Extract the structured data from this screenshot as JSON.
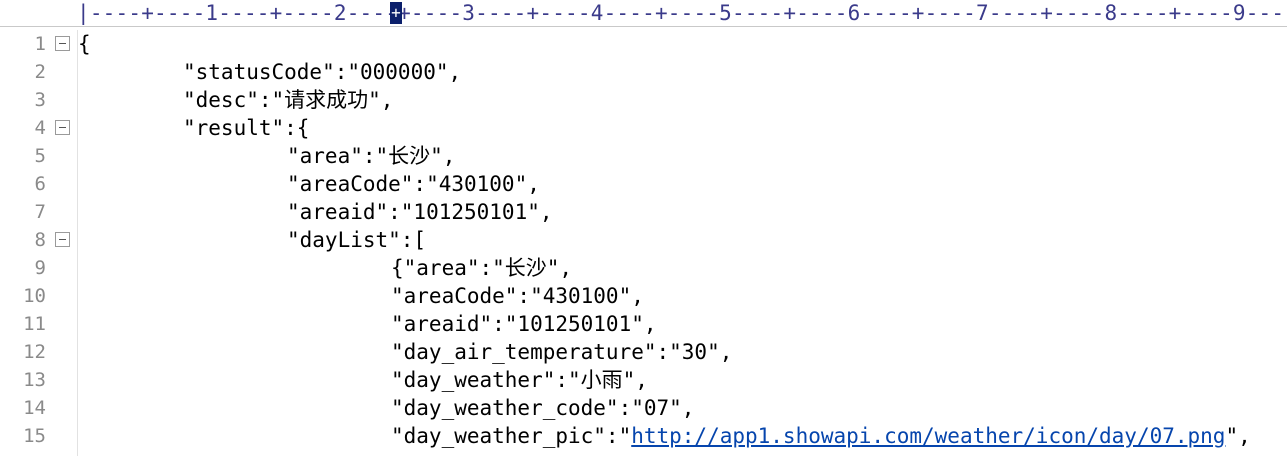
{
  "ruler": {
    "text": "|----+----1----+----2----+----3----+----4----+----5----+----6----+----7----+----8----+----9----+"
  },
  "lines": [
    {
      "n": "1",
      "fold": true,
      "indent": 0,
      "text": "{"
    },
    {
      "n": "2",
      "fold": false,
      "indent": 1,
      "text": "\"statusCode\":\"000000\","
    },
    {
      "n": "3",
      "fold": false,
      "indent": 1,
      "text": "\"desc\":\"请求成功\","
    },
    {
      "n": "4",
      "fold": true,
      "indent": 1,
      "text": "\"result\":{"
    },
    {
      "n": "5",
      "fold": false,
      "indent": 2,
      "text": "\"area\":\"长沙\","
    },
    {
      "n": "6",
      "fold": false,
      "indent": 2,
      "text": "\"areaCode\":\"430100\","
    },
    {
      "n": "7",
      "fold": false,
      "indent": 2,
      "text": "\"areaid\":\"101250101\","
    },
    {
      "n": "8",
      "fold": true,
      "indent": 2,
      "text": "\"dayList\":["
    },
    {
      "n": "9",
      "fold": false,
      "indent": 3,
      "text": "{\"area\":\"长沙\","
    },
    {
      "n": "10",
      "fold": false,
      "indent": 3,
      "text": "\"areaCode\":\"430100\","
    },
    {
      "n": "11",
      "fold": false,
      "indent": 3,
      "text": "\"areaid\":\"101250101\","
    },
    {
      "n": "12",
      "fold": false,
      "indent": 3,
      "text": "\"day_air_temperature\":\"30\","
    },
    {
      "n": "13",
      "fold": false,
      "indent": 3,
      "text": "\"day_weather\":\"小雨\","
    },
    {
      "n": "14",
      "fold": false,
      "indent": 3,
      "text": "\"day_weather_code\":\"07\","
    },
    {
      "n": "15",
      "fold": false,
      "indent": 3,
      "text_before": "\"day_weather_pic\":\"",
      "link": "http://app1.showapi.com/weather/icon/day/07.png",
      "text_after": "\","
    }
  ]
}
